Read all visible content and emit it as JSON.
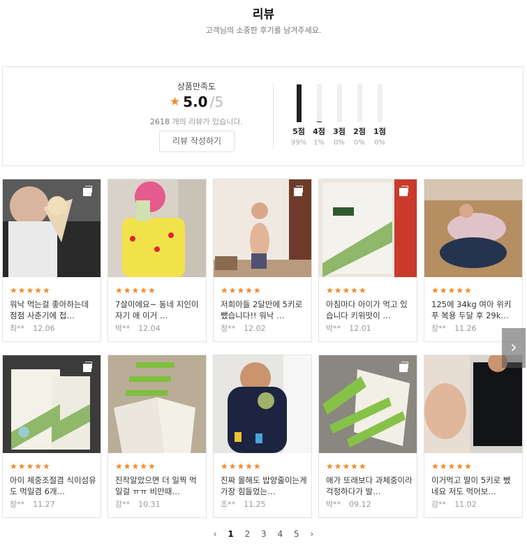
{
  "header": {
    "title": "리뷰",
    "subtitle": "고객님의 소중한 후기를 남겨주세요."
  },
  "summary": {
    "satisfaction_label": "상품만족도",
    "score": "5.0",
    "score_max": "/5",
    "review_count": "2618",
    "review_count_suffix": " 개의 리뷰가 있습니다.",
    "write_button": "리뷰 작성하기",
    "accent_color": "#f28a2c",
    "distribution": [
      {
        "label": "5점",
        "pct": "99%",
        "value": 0.99
      },
      {
        "label": "4점",
        "pct": "1%",
        "value": 0.01
      },
      {
        "label": "3점",
        "pct": "0%",
        "value": 0
      },
      {
        "label": "2점",
        "pct": "0%",
        "value": 0
      },
      {
        "label": "1점",
        "pct": "0%",
        "value": 0
      }
    ]
  },
  "reviews": [
    {
      "text": "워낙 먹는걸 좋아하는데 점점 사춘기에 접…",
      "author": "최**",
      "date": "12.06",
      "stars": "★★★★★",
      "multi_photo": true
    },
    {
      "text": "7살이에요~ 동네 지인이 자기 애 이거 …",
      "author": "박**",
      "date": "12.04",
      "stars": "★★★★★",
      "multi_photo": false
    },
    {
      "text": "저희아들 2달만에 5키로 뺐습니다!! 워낙 …",
      "author": "정**",
      "date": "12.02",
      "stars": "★★★★★",
      "multi_photo": true
    },
    {
      "text": "아침마다 아이가 먹고 있습니다 키위맛이 …",
      "author": "박**",
      "date": "12.01",
      "stars": "★★★★★",
      "multi_photo": true
    },
    {
      "text": "125에 34kg 여아 위키푸 복용 두달 후 29k…",
      "author": "장**",
      "date": "11.26",
      "stars": "★★★★★",
      "multi_photo": false
    },
    {
      "text": "아이 체중조절겸 식이섬유도 먹일겸 6개…",
      "author": "장**",
      "date": "11.27",
      "stars": "★★★★★",
      "multi_photo": true
    },
    {
      "text": "진작알았으면 더 일찍 먹일걸 ㅠㅠ 비만때…",
      "author": "강**",
      "date": "10.31",
      "stars": "★★★★★",
      "multi_photo": false
    },
    {
      "text": "진짜 몰해도 밥양줄이는게 가장 힘들었는…",
      "author": "조**",
      "date": "11.25",
      "stars": "★★★★★",
      "multi_photo": false
    },
    {
      "text": "애가 또래보다 과체중이라 걱정하다가 발…",
      "author": "박**",
      "date": "09.12",
      "stars": "★★★★★",
      "multi_photo": true
    },
    {
      "text": "이거먹고 딸이 5키로 뺐네요 저도 먹어보…",
      "author": "강**",
      "date": "11.02",
      "stars": "★★★★★",
      "multi_photo": false
    }
  ],
  "pagination": {
    "prev": "‹",
    "pages": [
      "1",
      "2",
      "3",
      "4",
      "5"
    ],
    "current": "1",
    "next": "›"
  },
  "carousel": {
    "next_icon": "›"
  }
}
